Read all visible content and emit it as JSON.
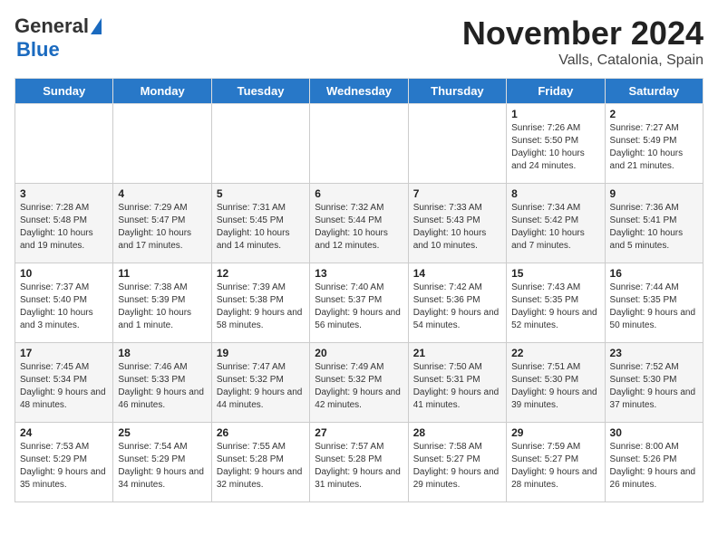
{
  "logo": {
    "part1": "General",
    "part2": "Blue"
  },
  "title": "November 2024",
  "subtitle": "Valls, Catalonia, Spain",
  "days_of_week": [
    "Sunday",
    "Monday",
    "Tuesday",
    "Wednesday",
    "Thursday",
    "Friday",
    "Saturday"
  ],
  "weeks": [
    [
      {
        "day": "",
        "info": ""
      },
      {
        "day": "",
        "info": ""
      },
      {
        "day": "",
        "info": ""
      },
      {
        "day": "",
        "info": ""
      },
      {
        "day": "",
        "info": ""
      },
      {
        "day": "1",
        "info": "Sunrise: 7:26 AM\nSunset: 5:50 PM\nDaylight: 10 hours and 24 minutes."
      },
      {
        "day": "2",
        "info": "Sunrise: 7:27 AM\nSunset: 5:49 PM\nDaylight: 10 hours and 21 minutes."
      }
    ],
    [
      {
        "day": "3",
        "info": "Sunrise: 7:28 AM\nSunset: 5:48 PM\nDaylight: 10 hours and 19 minutes."
      },
      {
        "day": "4",
        "info": "Sunrise: 7:29 AM\nSunset: 5:47 PM\nDaylight: 10 hours and 17 minutes."
      },
      {
        "day": "5",
        "info": "Sunrise: 7:31 AM\nSunset: 5:45 PM\nDaylight: 10 hours and 14 minutes."
      },
      {
        "day": "6",
        "info": "Sunrise: 7:32 AM\nSunset: 5:44 PM\nDaylight: 10 hours and 12 minutes."
      },
      {
        "day": "7",
        "info": "Sunrise: 7:33 AM\nSunset: 5:43 PM\nDaylight: 10 hours and 10 minutes."
      },
      {
        "day": "8",
        "info": "Sunrise: 7:34 AM\nSunset: 5:42 PM\nDaylight: 10 hours and 7 minutes."
      },
      {
        "day": "9",
        "info": "Sunrise: 7:36 AM\nSunset: 5:41 PM\nDaylight: 10 hours and 5 minutes."
      }
    ],
    [
      {
        "day": "10",
        "info": "Sunrise: 7:37 AM\nSunset: 5:40 PM\nDaylight: 10 hours and 3 minutes."
      },
      {
        "day": "11",
        "info": "Sunrise: 7:38 AM\nSunset: 5:39 PM\nDaylight: 10 hours and 1 minute."
      },
      {
        "day": "12",
        "info": "Sunrise: 7:39 AM\nSunset: 5:38 PM\nDaylight: 9 hours and 58 minutes."
      },
      {
        "day": "13",
        "info": "Sunrise: 7:40 AM\nSunset: 5:37 PM\nDaylight: 9 hours and 56 minutes."
      },
      {
        "day": "14",
        "info": "Sunrise: 7:42 AM\nSunset: 5:36 PM\nDaylight: 9 hours and 54 minutes."
      },
      {
        "day": "15",
        "info": "Sunrise: 7:43 AM\nSunset: 5:35 PM\nDaylight: 9 hours and 52 minutes."
      },
      {
        "day": "16",
        "info": "Sunrise: 7:44 AM\nSunset: 5:35 PM\nDaylight: 9 hours and 50 minutes."
      }
    ],
    [
      {
        "day": "17",
        "info": "Sunrise: 7:45 AM\nSunset: 5:34 PM\nDaylight: 9 hours and 48 minutes."
      },
      {
        "day": "18",
        "info": "Sunrise: 7:46 AM\nSunset: 5:33 PM\nDaylight: 9 hours and 46 minutes."
      },
      {
        "day": "19",
        "info": "Sunrise: 7:47 AM\nSunset: 5:32 PM\nDaylight: 9 hours and 44 minutes."
      },
      {
        "day": "20",
        "info": "Sunrise: 7:49 AM\nSunset: 5:32 PM\nDaylight: 9 hours and 42 minutes."
      },
      {
        "day": "21",
        "info": "Sunrise: 7:50 AM\nSunset: 5:31 PM\nDaylight: 9 hours and 41 minutes."
      },
      {
        "day": "22",
        "info": "Sunrise: 7:51 AM\nSunset: 5:30 PM\nDaylight: 9 hours and 39 minutes."
      },
      {
        "day": "23",
        "info": "Sunrise: 7:52 AM\nSunset: 5:30 PM\nDaylight: 9 hours and 37 minutes."
      }
    ],
    [
      {
        "day": "24",
        "info": "Sunrise: 7:53 AM\nSunset: 5:29 PM\nDaylight: 9 hours and 35 minutes."
      },
      {
        "day": "25",
        "info": "Sunrise: 7:54 AM\nSunset: 5:29 PM\nDaylight: 9 hours and 34 minutes."
      },
      {
        "day": "26",
        "info": "Sunrise: 7:55 AM\nSunset: 5:28 PM\nDaylight: 9 hours and 32 minutes."
      },
      {
        "day": "27",
        "info": "Sunrise: 7:57 AM\nSunset: 5:28 PM\nDaylight: 9 hours and 31 minutes."
      },
      {
        "day": "28",
        "info": "Sunrise: 7:58 AM\nSunset: 5:27 PM\nDaylight: 9 hours and 29 minutes."
      },
      {
        "day": "29",
        "info": "Sunrise: 7:59 AM\nSunset: 5:27 PM\nDaylight: 9 hours and 28 minutes."
      },
      {
        "day": "30",
        "info": "Sunrise: 8:00 AM\nSunset: 5:26 PM\nDaylight: 9 hours and 26 minutes."
      }
    ]
  ]
}
